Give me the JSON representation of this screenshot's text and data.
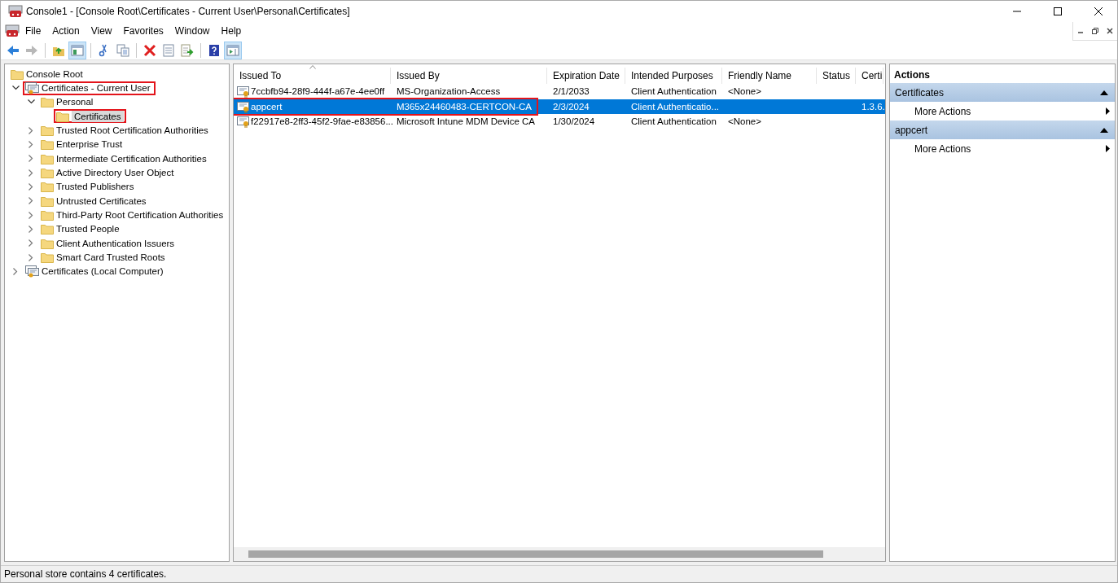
{
  "window": {
    "title": "Console1 - [Console Root\\Certificates - Current User\\Personal\\Certificates]"
  },
  "menu": [
    "File",
    "Action",
    "View",
    "Favorites",
    "Window",
    "Help"
  ],
  "toolbar": [
    {
      "kind": "back",
      "pressed": false,
      "disabled": false
    },
    {
      "kind": "forward",
      "pressed": false,
      "disabled": true
    },
    {
      "kind": "sep"
    },
    {
      "kind": "up",
      "pressed": false,
      "disabled": false
    },
    {
      "kind": "tree",
      "pressed": true,
      "disabled": false
    },
    {
      "kind": "sep"
    },
    {
      "kind": "cut",
      "pressed": false,
      "disabled": false
    },
    {
      "kind": "copy",
      "pressed": false,
      "disabled": false
    },
    {
      "kind": "sep"
    },
    {
      "kind": "delete",
      "pressed": false,
      "disabled": false
    },
    {
      "kind": "properties",
      "pressed": false,
      "disabled": false
    },
    {
      "kind": "export",
      "pressed": false,
      "disabled": false
    },
    {
      "kind": "sep"
    },
    {
      "kind": "help",
      "pressed": false,
      "disabled": false
    },
    {
      "kind": "actionpane",
      "pressed": true,
      "disabled": false
    }
  ],
  "tree": [
    {
      "label": "Console Root",
      "kind": "root",
      "selected": false,
      "outlined": false,
      "children": [
        {
          "label": "Certificates - Current User",
          "kind": "store",
          "expanded": true,
          "selected": false,
          "outlined": true,
          "children": [
            {
              "label": "Personal",
              "kind": "folder",
              "expanded": true,
              "selected": false,
              "outlined": false,
              "children": [
                {
                  "label": "Certificates",
                  "kind": "leaf",
                  "selected": true,
                  "outlined": true
                }
              ]
            },
            {
              "label": "Trusted Root Certification Authorities",
              "kind": "folder",
              "expanded": false,
              "selected": false,
              "outlined": false
            },
            {
              "label": "Enterprise Trust",
              "kind": "folder",
              "expanded": false,
              "selected": false,
              "outlined": false
            },
            {
              "label": "Intermediate Certification Authorities",
              "kind": "folder",
              "expanded": false,
              "selected": false,
              "outlined": false
            },
            {
              "label": "Active Directory User Object",
              "kind": "folder",
              "expanded": false,
              "selected": false,
              "outlined": false
            },
            {
              "label": "Trusted Publishers",
              "kind": "folder",
              "expanded": false,
              "selected": false,
              "outlined": false
            },
            {
              "label": "Untrusted Certificates",
              "kind": "folder",
              "expanded": false,
              "selected": false,
              "outlined": false
            },
            {
              "label": "Third-Party Root Certification Authorities",
              "kind": "folder",
              "expanded": false,
              "selected": false,
              "outlined": false
            },
            {
              "label": "Trusted People",
              "kind": "folder",
              "expanded": false,
              "selected": false,
              "outlined": false
            },
            {
              "label": "Client Authentication Issuers",
              "kind": "folder",
              "expanded": false,
              "selected": false,
              "outlined": false
            },
            {
              "label": "Smart Card Trusted Roots",
              "kind": "folder",
              "expanded": false,
              "selected": false,
              "outlined": false
            }
          ]
        },
        {
          "label": "Certificates (Local Computer)",
          "kind": "store",
          "expanded": false,
          "selected": false,
          "outlined": false
        }
      ]
    }
  ],
  "table": {
    "columns": [
      "Issued To",
      "Issued By",
      "Expiration Date",
      "Intended Purposes",
      "Friendly Name",
      "Status",
      "Certi"
    ],
    "rows": [
      {
        "selected": false,
        "outlined": false,
        "cells": [
          "7ccbfb94-28f9-444f-a67e-4ee0ff",
          "MS-Organization-Access",
          "2/1/2033",
          "Client Authentication",
          "<None>",
          "",
          ""
        ]
      },
      {
        "selected": true,
        "outlined": true,
        "cells": [
          "appcert",
          "M365x24460483-CERTCON-CA",
          "2/3/2024",
          "Client Authenticatio...",
          "",
          "",
          "1.3.6."
        ]
      },
      {
        "selected": false,
        "outlined": false,
        "cells": [
          "f22917e8-2ff3-45f2-9fae-e83856...",
          "Microsoft Intune MDM Device CA",
          "1/30/2024",
          "Client Authentication",
          "<None>",
          "",
          ""
        ]
      }
    ]
  },
  "actions": {
    "title": "Actions",
    "sections": [
      {
        "title": "Certificates",
        "expanded": true,
        "items": [
          "More Actions"
        ]
      },
      {
        "title": "appcert",
        "expanded": true,
        "items": [
          "More Actions"
        ]
      }
    ]
  },
  "status_bar": "Personal store contains 4 certificates."
}
